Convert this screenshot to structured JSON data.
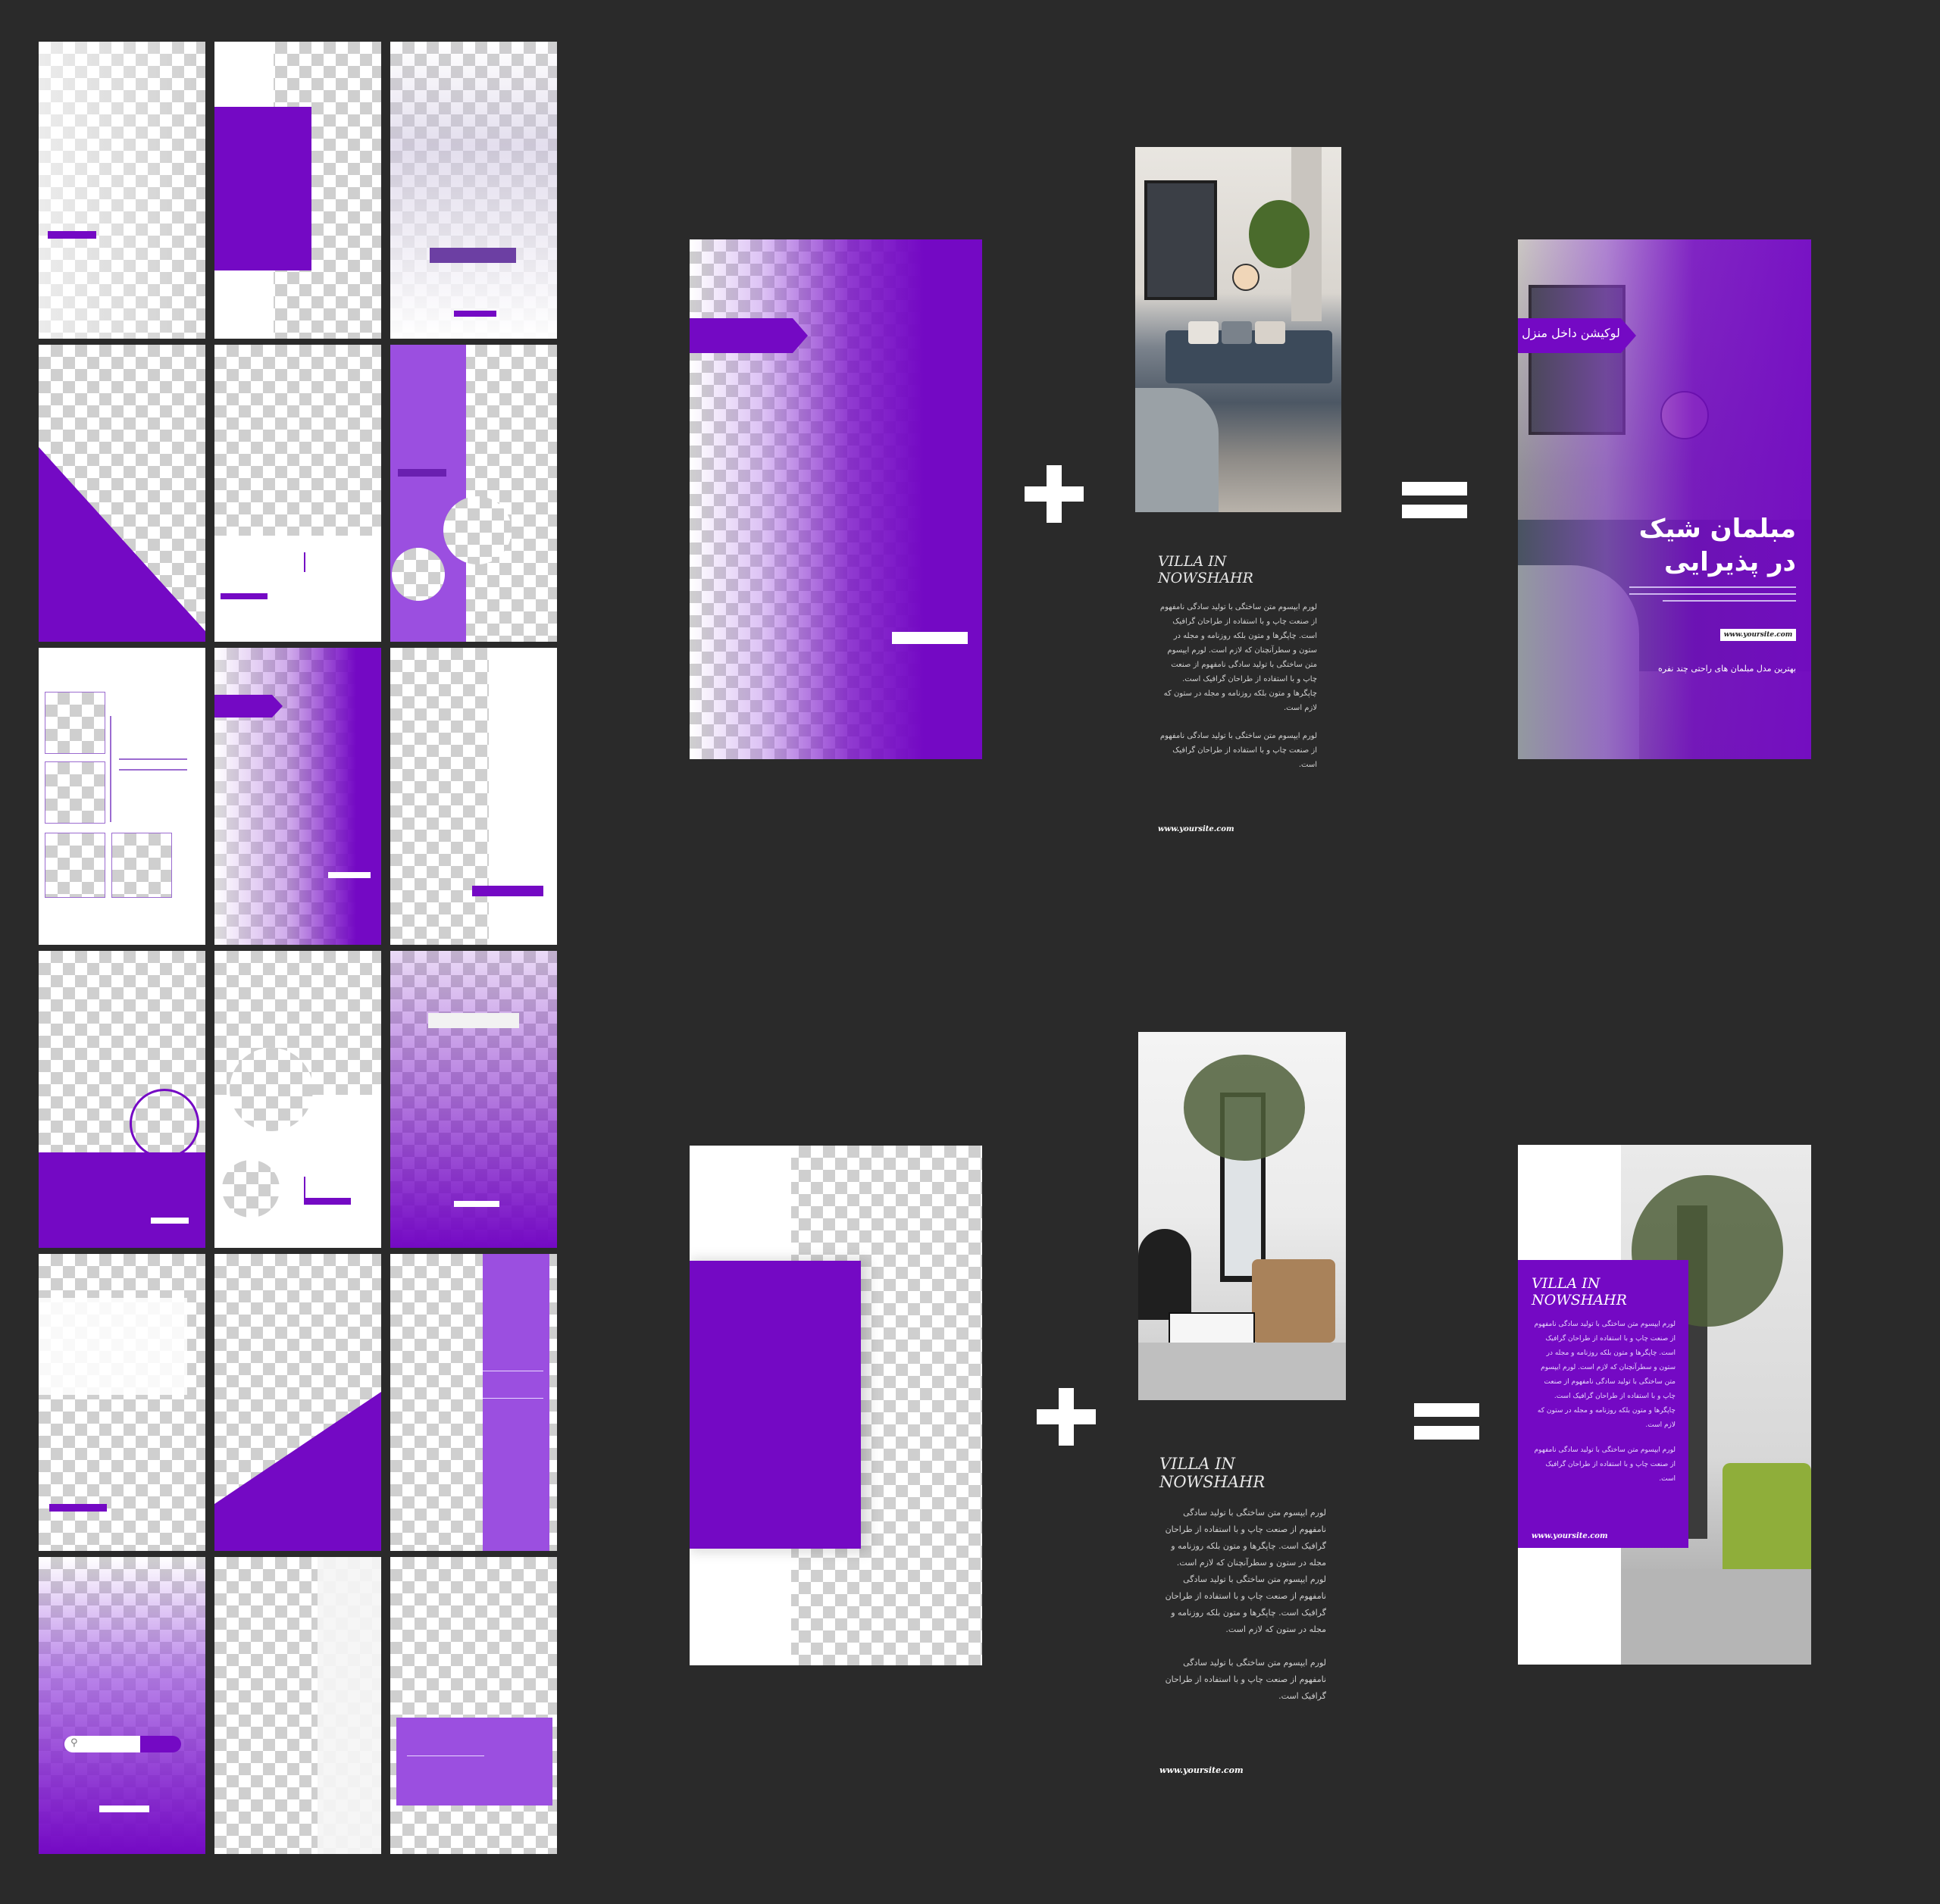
{
  "colors": {
    "background": "#2a2a2a",
    "accent": "#7409c4",
    "light_accent": "#9b4fe0"
  },
  "operators": {
    "plus": "+",
    "equals": "="
  },
  "example1": {
    "badge": "لوکیشن داخل منزل",
    "headline_1": "مبلمان شیک",
    "headline_2": "در پذیرایی",
    "website": "www.yoursite.com",
    "tagline": "بهترین مدل مبلمان های راحتی چند نفره",
    "caption_title": "VILLA IN NOWSHAHR",
    "caption_p1": "لورم ایپسوم متن ساختگی با تولید سادگی نامفهوم از صنعت چاپ و با استفاده از طراحان گرافیک است. چاپگرها و متون بلکه روزنامه و مجله در ستون و سطرآنچنان که لازم است. لورم ایپسوم متن ساختگی با تولید سادگی نامفهوم از صنعت چاپ و با استفاده از طراحان گرافیک است. چاپگرها و متون بلکه روزنامه و مجله در ستون که لازم است.",
    "caption_p2": "لورم ایپسوم متن ساختگی با تولید سادگی نامفهوم از صنعت چاپ و با استفاده از طراحان گرافیک است.",
    "caption_site": "www.yoursite.com"
  },
  "example2": {
    "title": "VILLA IN NOWSHAHR",
    "p1": "لورم ایپسوم متن ساختگی با تولید سادگی نامفهوم از صنعت چاپ و با استفاده از طراحان گرافیک است. چاپگرها و متون بلکه روزنامه و مجله در ستون و سطرآنچنان که لازم است. لورم ایپسوم متن ساختگی با تولید سادگی نامفهوم از صنعت چاپ و با استفاده از طراحان گرافیک است. چاپگرها و متون بلکه روزنامه و مجله در ستون که لازم است.",
    "p2": "لورم ایپسوم متن ساختگی با تولید سادگی نامفهوم از صنعت چاپ و با استفاده از طراحان گرافیک است.",
    "website": "www.yoursite.com",
    "caption_title": "VILLA IN NOWSHAHR",
    "caption_p1": "لورم ایپسوم متن ساختگی با تولید سادگی نامفهوم از صنعت چاپ و با استفاده از طراحان گرافیک است. چاپگرها و متون بلکه روزنامه و مجله در ستون و سطرآنچنان که لازم است. لورم ایپسوم متن ساختگی با تولید سادگی نامفهوم از صنعت چاپ و با استفاده از طراحان گرافیک است. چاپگرها و متون بلکه روزنامه و مجله در ستون که لازم است.",
    "caption_p2": "لورم ایپسوم متن ساختگی با تولید سادگی نامفهوم از صنعت چاپ و با استفاده از طراحان گرافیک است.",
    "caption_site": "www.yoursite.com"
  }
}
